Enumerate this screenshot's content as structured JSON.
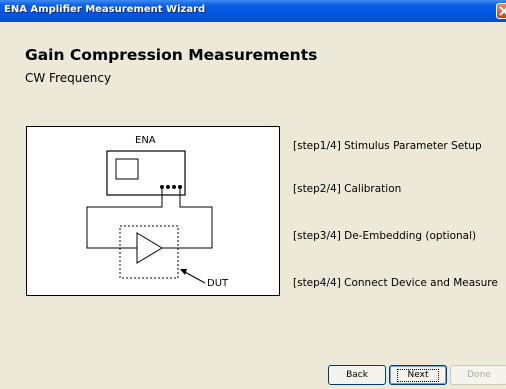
{
  "window": {
    "title": "ENA Amplifier Measurement Wizard",
    "close_icon": "close-icon"
  },
  "header": {
    "title": "Gain Compression Measurements",
    "subtitle": "CW Frequency"
  },
  "diagram": {
    "instrument_label": "ENA",
    "device_label": "DUT"
  },
  "steps": [
    {
      "label": "[step1/4] Stimulus Parameter Setup"
    },
    {
      "label": "[step2/4] Calibration"
    },
    {
      "label": "[step3/4] De-Embedding (optional)"
    },
    {
      "label": "[step4/4] Connect Device and Measure"
    }
  ],
  "buttons": {
    "back": "Back",
    "next": "Next",
    "done": "Done"
  }
}
